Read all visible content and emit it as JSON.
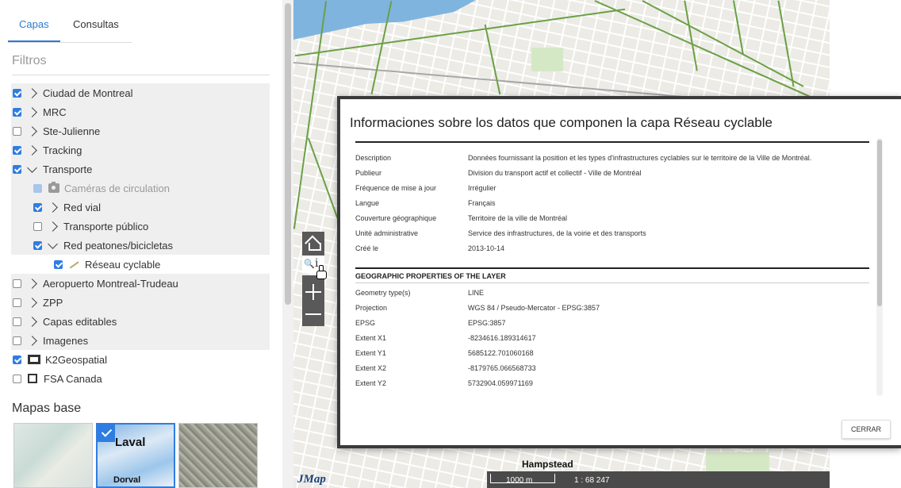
{
  "tabs": [
    {
      "label": "Capas"
    },
    {
      "label": "Consultas"
    }
  ],
  "filters_label": "Filtros",
  "layers": [
    {
      "label": "Ciudad de Montreal",
      "checked": true
    },
    {
      "label": "MRC",
      "checked": true
    },
    {
      "label": "Ste-Julienne",
      "checked": false
    },
    {
      "label": "Tracking",
      "checked": true
    },
    {
      "label": "Transporte",
      "checked": true
    },
    {
      "label": "Caméras de circulation",
      "checked": true,
      "disabled": true
    },
    {
      "label": "Red vial",
      "checked": true
    },
    {
      "label": "Transporte público",
      "checked": false
    },
    {
      "label": "Red peatones/bicicletas",
      "checked": true
    },
    {
      "label": "Réseau cyclable",
      "checked": true
    },
    {
      "label": "Aeropuerto Montreal-Trudeau",
      "checked": false
    },
    {
      "label": "ZPP",
      "checked": false
    },
    {
      "label": "Capas editables",
      "checked": false
    },
    {
      "label": "Imagenes",
      "checked": false
    },
    {
      "label": "K2Geospatial",
      "checked": true
    },
    {
      "label": "FSA Canada",
      "checked": false
    }
  ],
  "basemaps_label": "Mapas base",
  "basemaps": [
    {
      "big_text": "",
      "small_text": ""
    },
    {
      "big_text": "Laval",
      "small_text": "Dorval",
      "selected": true
    },
    {
      "big_text": "",
      "small_text": ""
    }
  ],
  "map": {
    "logo": "JMap",
    "scale_distance": "1000 m",
    "scale_ratio": "1 : 68 247",
    "place_label": "Hampstead",
    "bike_color": "#6aa045",
    "water_color": "#7fb4df"
  },
  "modal": {
    "title": "Informaciones sobre los datos que componen la capa Réseau cyclable",
    "metadata": [
      {
        "key": "Description",
        "value": "Données fournissant la position et les types d'infrastructures cyclables sur le territoire de la Ville de Montréal."
      },
      {
        "key": "Publieur",
        "value": "Division du transport actif et collectif - Ville de Montréal"
      },
      {
        "key": "Fréquence de mise à jour",
        "value": "Irrégulier"
      },
      {
        "key": "Langue",
        "value": "Français"
      },
      {
        "key": "Couverture géographique",
        "value": "Territoire de la ville de Montréal"
      },
      {
        "key": "Unité administrative",
        "value": "Service des infrastructures, de la voirie et des transports"
      },
      {
        "key": "Créé le",
        "value": "2013-10-14"
      }
    ],
    "geo_section_title": "GEOGRAPHIC PROPERTIES OF THE LAYER",
    "geo": [
      {
        "key": "Geometry type(s)",
        "value": "LINE"
      },
      {
        "key": "Projection",
        "value": "WGS 84 / Pseudo-Mercator - EPSG:3857"
      },
      {
        "key": "EPSG",
        "value": "EPSG:3857"
      },
      {
        "key": "Extent X1",
        "value": "-8234616.189314617"
      },
      {
        "key": "Extent Y1",
        "value": "5685122.701060168"
      },
      {
        "key": "Extent X2",
        "value": "-8179765.066568733"
      },
      {
        "key": "Extent Y2",
        "value": "5732904.059971169"
      }
    ],
    "close_label": "CERRAR"
  },
  "colors": {
    "accent": "#2f7de1",
    "tab_active": "#2a7bd3"
  }
}
